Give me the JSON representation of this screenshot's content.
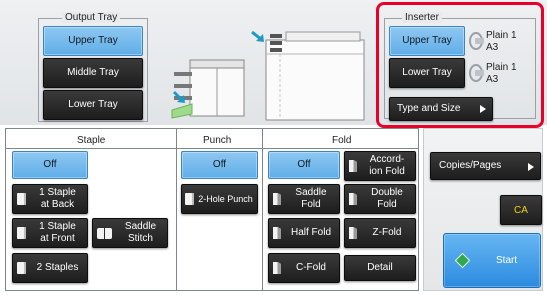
{
  "output_tray": {
    "title": "Output Tray",
    "upper": "Upper Tray",
    "middle": "Middle Tray",
    "lower": "Lower Tray"
  },
  "inserter": {
    "title": "Inserter",
    "upper": "Upper Tray",
    "lower": "Lower Tray",
    "upper_paper_type": "Plain 1",
    "upper_paper_size": "A3",
    "lower_paper_type": "Plain 1",
    "lower_paper_size": "A3",
    "type_and_size": "Type and Size",
    "highlight_color": "#e8002a"
  },
  "staple": {
    "title": "Staple",
    "off": "Off",
    "one_back_l1": "1 Staple",
    "one_back_l2": "at Back",
    "one_front_l1": "1 Staple",
    "one_front_l2": "at Front",
    "saddle_l1": "Saddle",
    "saddle_l2": "Stitch",
    "two": "2 Staples"
  },
  "punch": {
    "title": "Punch",
    "off": "Off",
    "two_hole": "2-Hole Punch"
  },
  "fold": {
    "title": "Fold",
    "off": "Off",
    "accordion_l1": "Accord-",
    "accordion_l2": "ion Fold",
    "saddle_l1": "Saddle",
    "saddle_l2": "Fold",
    "double_l1": "Double",
    "double_l2": "Fold",
    "half": "Half Fold",
    "z": "Z-Fold",
    "c": "C-Fold",
    "detail": "Detail"
  },
  "right": {
    "copies_pages": "Copies/Pages",
    "ca": "CA",
    "start": "Start"
  },
  "colors": {
    "selected": "#6cb6ec",
    "button_dark": "#262626",
    "ca_yellow": "#f2d200",
    "start_blue": "#3d9ae8",
    "start_diamond": "#2fa84f"
  }
}
